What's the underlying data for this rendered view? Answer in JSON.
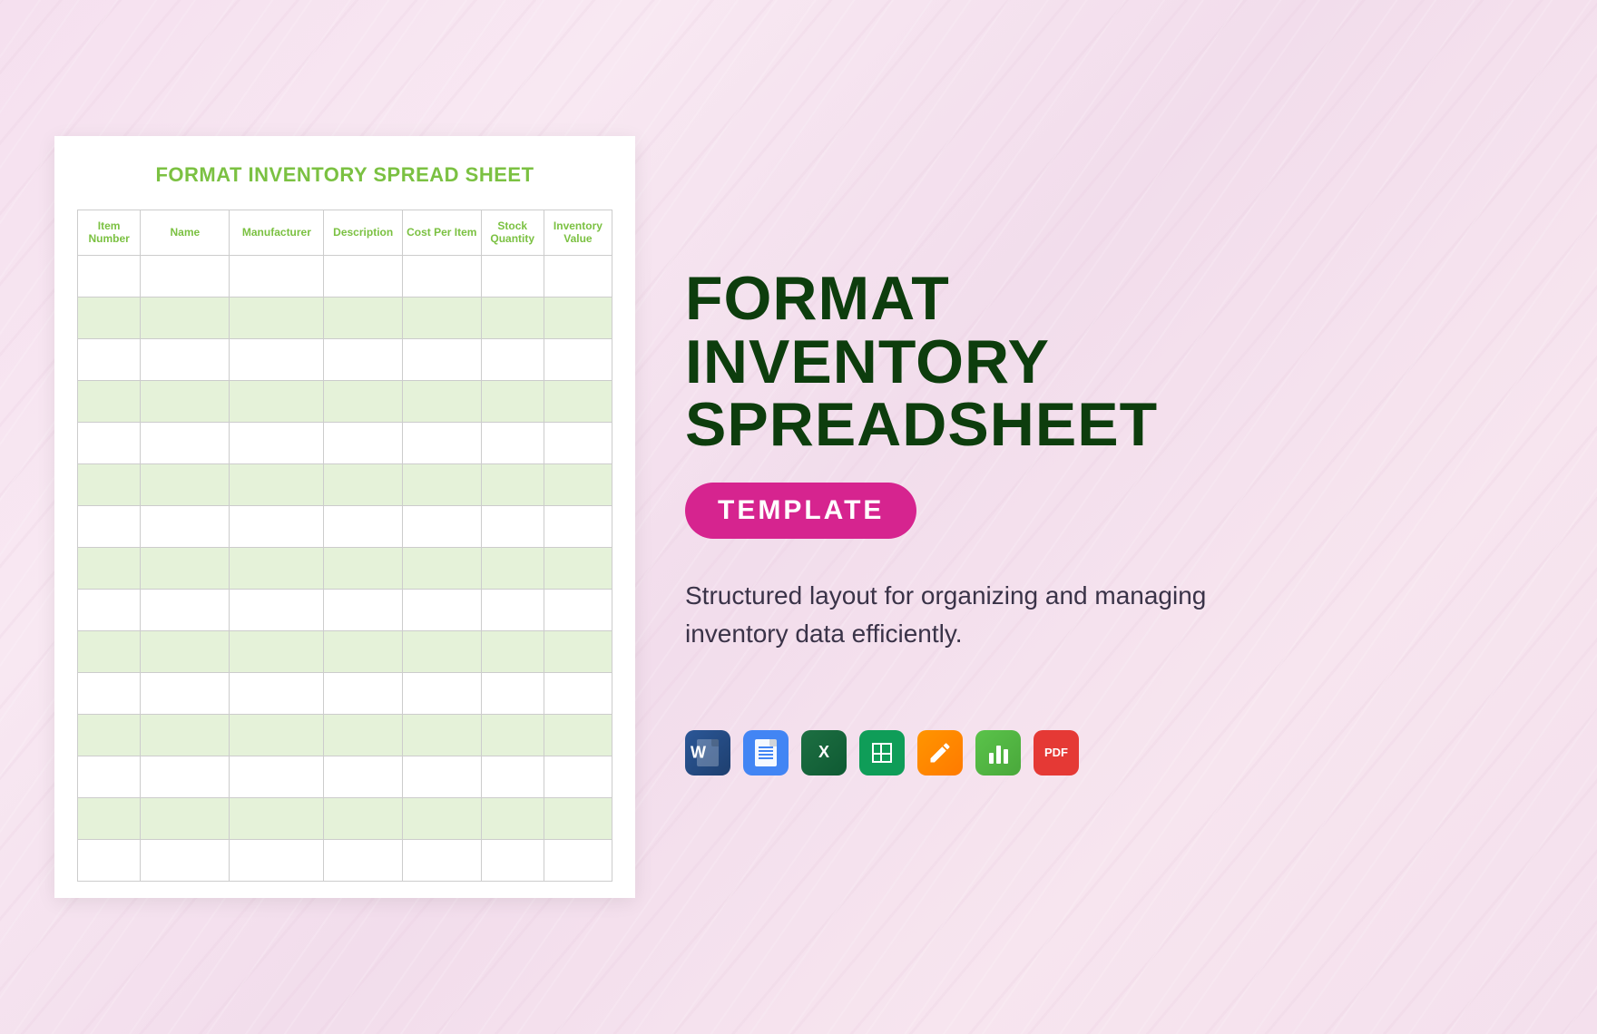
{
  "preview": {
    "title": "FORMAT INVENTORY SPREAD SHEET",
    "columns": [
      "Item Number",
      "Name",
      "Manufacturer",
      "Description",
      "Cost Per Item",
      "Stock Quantity",
      "Inventory Value"
    ],
    "row_count": 15
  },
  "info": {
    "title_line1": "FORMAT",
    "title_line2": "INVENTORY",
    "title_line3": "SPREADSHEET",
    "badge": "TEMPLATE",
    "description": "Structured layout for organizing and managing inventory data efficiently."
  },
  "formats": [
    {
      "name": "word",
      "label": "W"
    },
    {
      "name": "google-docs",
      "label": ""
    },
    {
      "name": "excel",
      "label": "X"
    },
    {
      "name": "google-sheets",
      "label": ""
    },
    {
      "name": "pages",
      "label": ""
    },
    {
      "name": "numbers",
      "label": ""
    },
    {
      "name": "pdf",
      "label": "PDF"
    }
  ]
}
